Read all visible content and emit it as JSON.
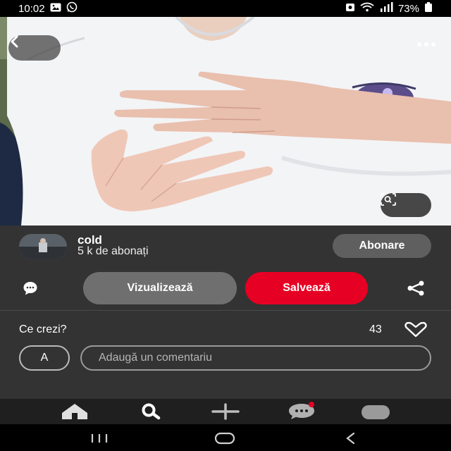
{
  "status_bar": {
    "time": "10:02",
    "battery": "73%",
    "icons": [
      "gallery-icon",
      "whatsapp-icon",
      "alarm-icon",
      "wifi-icon",
      "signal-icon",
      "battery-icon"
    ]
  },
  "pin": {
    "icons": [
      "back-arrow-icon",
      "more-dots-icon",
      "visual-search-icon"
    ]
  },
  "creator": {
    "name": "cold",
    "followers": "5 k de abonați",
    "follow_label": "Abonare"
  },
  "actions": {
    "view_label": "Vizualizează",
    "save_label": "Salvează",
    "icons": [
      "comment-icon",
      "share-icon"
    ]
  },
  "comments": {
    "question": "Ce crezi?",
    "like_count": "43",
    "avatar_initial": "A",
    "placeholder": "Adaugă un comentariu"
  },
  "bottom_nav": {
    "items": [
      "home-icon",
      "search-icon",
      "create-icon",
      "messages-icon",
      "profile-icon"
    ]
  },
  "system_nav": {
    "items": [
      "recents-icon",
      "home-button-icon",
      "back-icon"
    ]
  },
  "colors": {
    "accent_red": "#e60023",
    "panel_bg": "#333333",
    "nav_bg": "#1f1f1f"
  }
}
